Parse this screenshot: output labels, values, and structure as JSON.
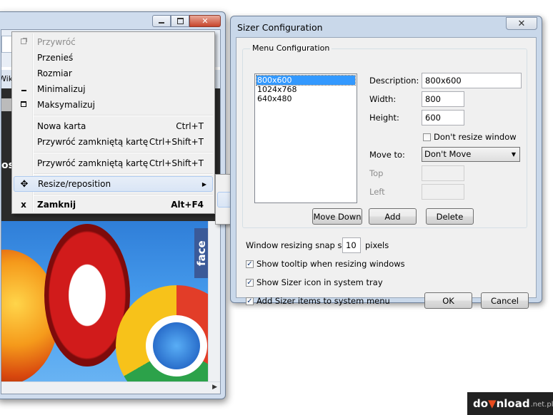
{
  "system_menu": {
    "items": [
      {
        "label": "Przywróć",
        "shortcut": "",
        "icon": "restore-icon"
      },
      {
        "label": "Przenieś",
        "shortcut": ""
      },
      {
        "label": "Rozmiar",
        "shortcut": ""
      },
      {
        "label": "Minimalizuj",
        "shortcut": "",
        "icon": "minimize-icon"
      },
      {
        "label": "Maksymalizuj",
        "shortcut": "",
        "icon": "maximize-icon"
      },
      {
        "label": "Nowa karta",
        "shortcut": "Ctrl+T"
      },
      {
        "label": "Przywróć zamkniętą kartę",
        "shortcut": "Ctrl+Shift+T"
      },
      {
        "label": "Przywróć zamkniętą kartę",
        "shortcut": "Ctrl+Shift+T"
      },
      {
        "label": "Resize/reposition",
        "shortcut": "",
        "icon": "move-cross-icon"
      },
      {
        "label": "Zamknij",
        "shortcut": "Alt+F4",
        "icon": "close-x-icon"
      }
    ]
  },
  "resize_submenu": {
    "items": [
      {
        "label": "800x600"
      },
      {
        "label": "1024x768"
      },
      {
        "label": "640x480"
      }
    ]
  },
  "browser": {
    "bookmark_fragment": "Wik",
    "banner_fragment": "os",
    "side_tab_fragment": "face"
  },
  "dialog": {
    "title": "Sizer Configuration",
    "close_glyph": "✕",
    "menu_config": {
      "group_label": "Menu Configuration",
      "list_items": [
        "800x600",
        "1024x768",
        "640x480"
      ],
      "selected_index": 0,
      "description_label": "Description:",
      "description_value": "800x600",
      "width_label": "Width:",
      "width_value": "800",
      "height_label": "Height:",
      "height_value": "600",
      "dont_resize_label": "Don't resize window",
      "dont_resize_checked": false,
      "move_to_label": "Move to:",
      "move_to_value": "Don't Move",
      "top_label": "Top",
      "left_label": "Left",
      "move_down_label": "Move Down",
      "add_label": "Add",
      "delete_label": "Delete"
    },
    "snap_label": "Window resizing snap size:",
    "snap_value": "10",
    "snap_unit": "pixels",
    "show_tooltip_label": "Show tooltip when resizing windows",
    "show_tooltip_checked": true,
    "show_icon_label": "Show Sizer icon in system tray",
    "show_icon_checked": true,
    "add_items_label": "Add Sizer items to system menu",
    "add_items_checked": true,
    "ok_label": "OK",
    "cancel_label": "Cancel"
  },
  "watermark": {
    "part1": "do",
    "part2": "nload",
    "tld": ".net.pl"
  }
}
